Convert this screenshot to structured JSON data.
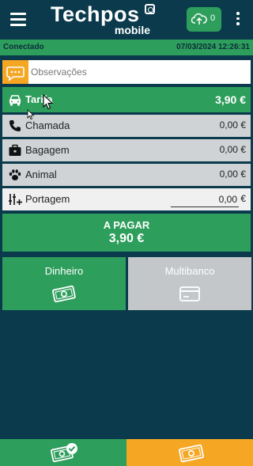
{
  "app": {
    "brand_name": "Techpos",
    "brand_sub": "mobile",
    "sync_count": "0"
  },
  "status": {
    "connection": "Conectado",
    "datetime": "07/03/2024 12:26:31"
  },
  "observations": {
    "placeholder": "Observações"
  },
  "rows": [
    {
      "label": "Tarifa",
      "amount": "3,90 €",
      "icon": "taxi-icon"
    },
    {
      "label": "Chamada",
      "amount": "0,00 €",
      "icon": "phone-icon"
    },
    {
      "label": "Bagagem",
      "amount": "0,00 €",
      "icon": "briefcase-icon"
    },
    {
      "label": "Animal",
      "amount": "0,00 €",
      "icon": "paw-icon"
    }
  ],
  "toll": {
    "label": "Portagem",
    "value": "0,00",
    "currency": "€",
    "icon": "sliders-plus-icon"
  },
  "payment": {
    "label": "A PAGAR",
    "amount": "3,90 €"
  },
  "methods": {
    "cash": "Dinheiro",
    "card": "Multibanco"
  },
  "colors": {
    "background": "#0b3a4c",
    "accent_green": "#2e9e5c",
    "accent_orange": "#f5a623",
    "inactive_gray": "#c3c7ca"
  }
}
